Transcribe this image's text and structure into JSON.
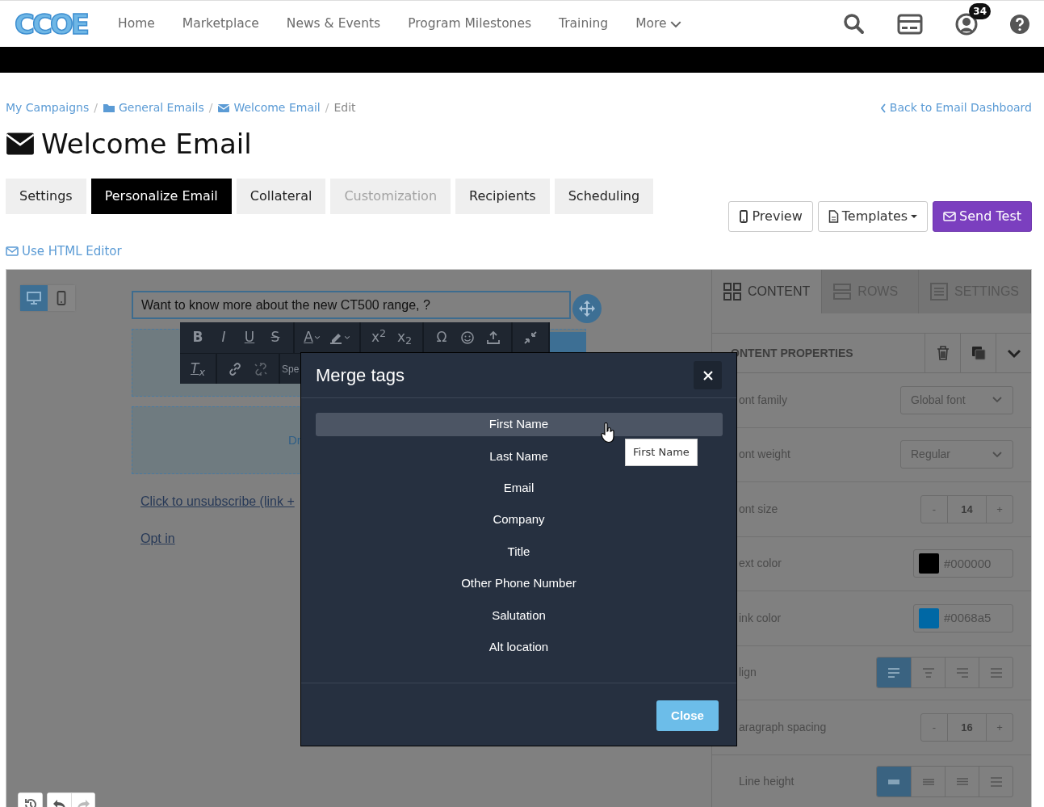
{
  "logo": {
    "text": "CCOE"
  },
  "nav": {
    "items": [
      {
        "label": "Home",
        "dropdown": false
      },
      {
        "label": "Marketplace",
        "dropdown": false
      },
      {
        "label": "News & Events",
        "dropdown": false
      },
      {
        "label": "Program Milestones",
        "dropdown": false
      },
      {
        "label": "Training",
        "dropdown": false
      },
      {
        "label": "More",
        "dropdown": true
      }
    ],
    "notification_count": "34"
  },
  "breadcrumb": [
    {
      "label": "My Campaigns",
      "kind": "plain",
      "active": false
    },
    {
      "separator": "/",
      "label": "General Emails",
      "kind": "folder",
      "active": false
    },
    {
      "separator": "/",
      "label": "Welcome Email",
      "kind": "envelope",
      "active": false
    },
    {
      "separator": "/",
      "label": "Edit",
      "kind": "plain",
      "active": true
    }
  ],
  "back_link": "Back to Email Dashboard",
  "title": "Welcome Email",
  "tabs": [
    {
      "label": "Settings",
      "selected": false,
      "disabled": false
    },
    {
      "label": "Personalize Email",
      "selected": true,
      "disabled": false
    },
    {
      "label": "Collateral",
      "selected": false,
      "disabled": false
    },
    {
      "label": "Customization",
      "selected": false,
      "disabled": true
    },
    {
      "label": "Recipients",
      "selected": false,
      "disabled": false
    },
    {
      "label": "Scheduling",
      "selected": false,
      "disabled": false
    }
  ],
  "actions": [
    {
      "label": "Preview",
      "kind": "preview"
    },
    {
      "label": "Templates",
      "kind": "templates"
    },
    {
      "label": "Send Test",
      "kind": "send"
    }
  ],
  "html_editor_link": "Use HTML Editor",
  "canvas": {
    "devices": [
      {
        "kind": "desktop",
        "selected": true
      },
      {
        "kind": "mobile",
        "selected": false
      }
    ],
    "text_block": "Want to know more about the new CT500 range, ?",
    "toolbar": [
      [
        {
          "label": "B",
          "kind": "bold"
        },
        {
          "label": "I",
          "kind": "italic"
        },
        {
          "label": "U",
          "kind": "underline"
        },
        {
          "label": "S",
          "kind": "strike"
        }
      ],
      [
        {
          "label": "A",
          "kind": "textcolor"
        },
        {
          "kind": "highlight"
        }
      ],
      [
        {
          "label": "x$^{2}$",
          "kind": "sup"
        },
        {
          "label": "x$_{2}$",
          "kind": "sub"
        }
      ],
      [
        {
          "label": "Ω",
          "kind": "char"
        },
        {
          "kind": "emoji"
        },
        {
          "kind": "insert"
        }
      ],
      [
        {
          "kind": "collapse"
        }
      ]
    ],
    "toolbar_row2": [
      [
        {
          "label": "T$_{x}$",
          "kind": "clear"
        }
      ],
      [
        {
          "kind": "link"
        },
        {
          "kind": "unlink"
        }
      ],
      [
        {
          "label": "Spe",
          "kind": "special"
        }
      ]
    ],
    "drop_hint": "Dr",
    "links": [
      "Click to unsubscribe (link +",
      "Opt in"
    ]
  },
  "panel": {
    "tabs": [
      {
        "label": "CONTENT",
        "kind": "content",
        "selected": true
      },
      {
        "label": "ROWS",
        "kind": "rows",
        "selected": false
      },
      {
        "label": "SETTINGS",
        "kind": "settings",
        "selected": false
      }
    ],
    "section_title": "ONTENT PROPERTIES",
    "properties": [
      {
        "label": "ont family",
        "kind": "select",
        "value": "Global font"
      },
      {
        "label": "ont weight",
        "kind": "select",
        "value": "Regular"
      },
      {
        "label": "ont size",
        "kind": "stepper",
        "value": "14",
        "decrement": "-",
        "increment": "+"
      },
      {
        "label": "ext color",
        "kind": "color",
        "value": "#000000"
      },
      {
        "label": "ink color",
        "kind": "color",
        "value": "#0068a5"
      },
      {
        "label": "lign",
        "kind": "align",
        "options": [
          {
            "kind": "left",
            "selected": true
          },
          {
            "kind": "center",
            "selected": false
          },
          {
            "kind": "right",
            "selected": false
          },
          {
            "kind": "justify",
            "selected": false
          }
        ]
      },
      {
        "label": "aragraph spacing",
        "kind": "stepper",
        "value": "16",
        "decrement": "-",
        "increment": "+"
      },
      {
        "label": "Line height",
        "kind": "lineheight",
        "options": [
          {
            "kind": "tight",
            "selected": true
          },
          {
            "kind": "normal",
            "selected": false
          },
          {
            "kind": "loose",
            "selected": false
          },
          {
            "kind": "wide",
            "selected": false
          }
        ]
      }
    ]
  },
  "modal": {
    "title": "Merge tags",
    "items": [
      {
        "label": "First Name",
        "selected": true
      },
      {
        "label": "Last Name",
        "selected": false
      },
      {
        "label": "Email",
        "selected": false
      },
      {
        "label": "Company",
        "selected": false
      },
      {
        "label": "Title",
        "selected": false
      },
      {
        "label": "Other Phone Number",
        "selected": false
      },
      {
        "label": "Salutation",
        "selected": false
      },
      {
        "label": "Alt location",
        "selected": false
      }
    ],
    "tooltip": "First Name",
    "close": "Close"
  }
}
